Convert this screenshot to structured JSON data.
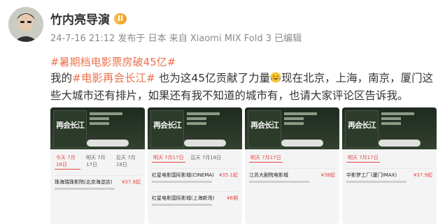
{
  "post": {
    "username": "竹内亮导演",
    "vip_badge": "II",
    "meta": "24-7-16 21:12 发布于 日本 来自 Xiaomi MIX Fold 3 已编辑",
    "title_tag": "#暑期档电影票房破45亿#",
    "content_prefix": "我的",
    "content_tag": "#电影再会长江#",
    "content_mid": " 也为这45亿贡献了力量",
    "content_suffix": "现在北京，上海，南京，厦门这些大城市还有排片，如果还有我不知道的城市有，也请大家评论区告诉我。"
  },
  "thumbnails": [
    {
      "id": "t1",
      "poster_title": "再会长江",
      "tabs": [
        "今天 7月16日",
        "明天 7月17日",
        "后天 7月18日"
      ],
      "active": 0,
      "cinemas": [
        {
          "name": "珠海瑞珠影院(北京海淀店)",
          "price": "¥37.9起"
        }
      ]
    },
    {
      "id": "t2",
      "poster_title": "再会长江",
      "tabs": [
        "明天 7月17日",
        "后天 7月18日"
      ],
      "active": 0,
      "cinemas": [
        {
          "name": "红星电影国际影城(CINEMA)",
          "price": "¥35.1起"
        },
        {
          "name": "红星电影国际影城(上海新场)",
          "price": "¥6期"
        }
      ]
    },
    {
      "id": "t3",
      "poster_title": "再会长江",
      "tabs": [
        "明天 7月17日"
      ],
      "active": 0,
      "cinemas": [
        {
          "name": "江苏大剧院电影城",
          "price": "¥38起"
        }
      ]
    },
    {
      "id": "t4",
      "poster_title": "再会长江",
      "tabs": [
        "明天 7月17日"
      ],
      "active": 0,
      "cinemas": [
        {
          "name": "中影梦工厂(厦门IMAX)",
          "price": "¥37.9起"
        }
      ]
    }
  ]
}
